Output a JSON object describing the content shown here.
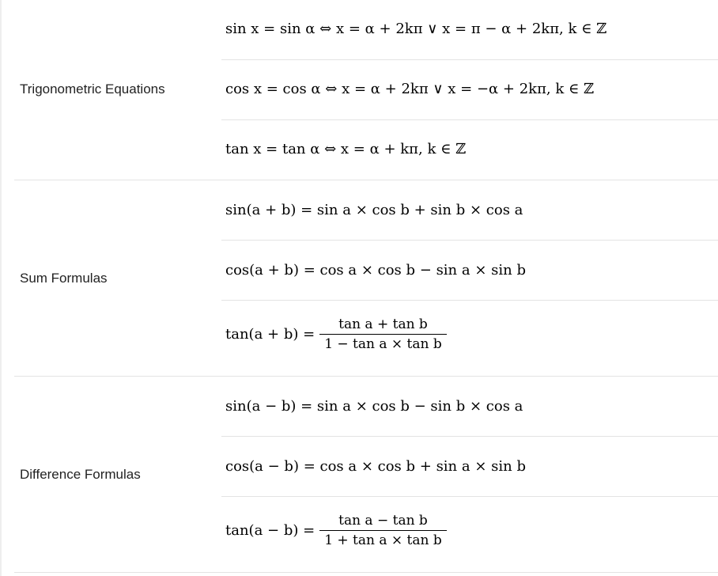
{
  "groups": [
    {
      "label": "Trigonometric Equations",
      "rows": [
        {
          "text": "sin x = sin α ⇔ x = α + 2kπ ∨ x = π − α + 2kπ, k ∈ ℤ"
        },
        {
          "text": "cos x = cos α ⇔ x = α + 2kπ ∨ x = −α + 2kπ, k ∈ ℤ"
        },
        {
          "text": "tan x = tan α ⇔ x = α + kπ, k ∈ ℤ"
        }
      ]
    },
    {
      "label": "Sum Formulas",
      "rows": [
        {
          "text": "sin(a + b) = sin a × cos b + sin b × cos a"
        },
        {
          "text": "cos(a + b) = cos a × cos b − sin a × sin b"
        },
        {
          "lhs": "tan(a + b) =",
          "numerator": "tan a + tan b",
          "denominator": "1 − tan a × tan b"
        }
      ]
    },
    {
      "label": "Difference Formulas",
      "rows": [
        {
          "text": "sin(a − b) = sin a × cos b − sin b × cos a"
        },
        {
          "text": "cos(a − b) = cos a × cos b + sin a × sin b"
        },
        {
          "lhs": "tan(a − b) =",
          "numerator": "tan a − tan b",
          "denominator": "1 + tan a × tan b"
        }
      ]
    }
  ]
}
